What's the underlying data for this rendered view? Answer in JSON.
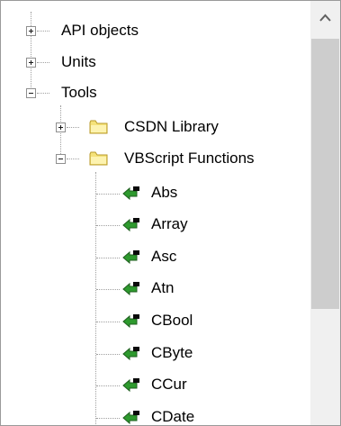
{
  "tree": {
    "top_items": [
      {
        "label": "API objects",
        "state": "collapsed"
      },
      {
        "label": "Units",
        "state": "collapsed"
      },
      {
        "label": "Tools",
        "state": "expanded"
      }
    ],
    "tools_children": [
      {
        "label": "CSDN Library",
        "state": "collapsed",
        "icon": "folder-icon"
      },
      {
        "label": "VBScript Functions",
        "state": "expanded",
        "icon": "folder-icon"
      }
    ],
    "vbscript_functions": [
      "Abs",
      "Array",
      "Asc",
      "Atn",
      "CBool",
      "CByte",
      "CCur",
      "CDate"
    ]
  },
  "colors": {
    "folder_fill": "#f5e27a",
    "folder_edge": "#b89a2a",
    "function_icon_green": "#2e9a2e",
    "scrollbar_track": "#f0f0f0",
    "scrollbar_thumb": "#cdcdcd"
  }
}
